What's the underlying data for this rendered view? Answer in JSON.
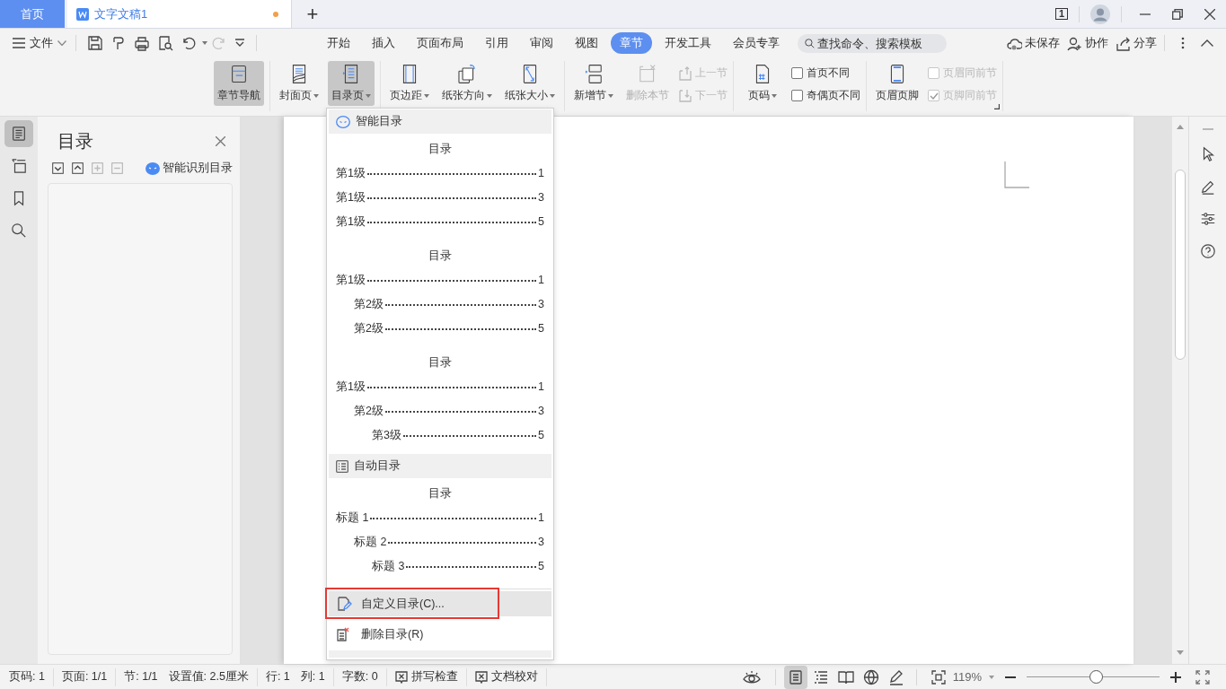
{
  "tabs": [
    {
      "label": "首页",
      "kind": "home",
      "selected": false
    },
    {
      "label": "文字文稿1",
      "kind": "document",
      "selected": true,
      "unsaved": true
    }
  ],
  "new_tab": "+",
  "window_badge": "1",
  "menu_bar": {
    "file": "文件",
    "ribbon_tabs": [
      {
        "label": "开始",
        "selected": false
      },
      {
        "label": "插入",
        "selected": false
      },
      {
        "label": "页面布局",
        "selected": false
      },
      {
        "label": "引用",
        "selected": false
      },
      {
        "label": "审阅",
        "selected": false
      },
      {
        "label": "视图",
        "selected": false
      },
      {
        "label": "章节",
        "selected": true
      },
      {
        "label": "开发工具",
        "selected": false
      },
      {
        "label": "会员专享",
        "selected": false
      }
    ],
    "search": {
      "placeholder": "查找命令、搜索模板"
    },
    "actions": [
      "未保存",
      "协作",
      "分享"
    ]
  },
  "ribbon_groups": [
    [
      {
        "kind": "big",
        "label": "章节导航",
        "dropdown": false,
        "pressed": true,
        "disabled": false
      }
    ],
    [
      {
        "kind": "big",
        "label": "封面页",
        "dropdown": true,
        "pressed": false,
        "disabled": false
      },
      {
        "kind": "big",
        "label": "目录页",
        "dropdown": true,
        "pressed": true,
        "disabled": false
      }
    ],
    [
      {
        "kind": "big",
        "label": "页边距",
        "dropdown": true,
        "pressed": false,
        "disabled": false
      },
      {
        "kind": "big",
        "label": "纸张方向",
        "dropdown": true,
        "pressed": false,
        "disabled": false
      },
      {
        "kind": "big",
        "label": "纸张大小",
        "dropdown": true,
        "pressed": false,
        "disabled": false
      }
    ],
    [
      {
        "kind": "big",
        "label": "新增节",
        "dropdown": true,
        "pressed": false,
        "disabled": false
      },
      {
        "kind": "big",
        "label": "删除本节",
        "dropdown": false,
        "pressed": false,
        "disabled": true
      },
      {
        "kind": "stack",
        "items": [
          {
            "label": "上一节",
            "disabled": true
          },
          {
            "label": "下一节",
            "disabled": true
          }
        ]
      }
    ],
    [
      {
        "kind": "big",
        "label": "页码",
        "dropdown": true,
        "pressed": false,
        "disabled": false
      },
      {
        "kind": "checks",
        "items": [
          {
            "label": "首页不同",
            "checked": false,
            "disabled": false
          },
          {
            "label": "奇偶页不同",
            "checked": false,
            "disabled": false
          }
        ]
      }
    ],
    [
      {
        "kind": "big",
        "label": "页眉页脚",
        "dropdown": false,
        "pressed": false,
        "disabled": false
      },
      {
        "kind": "checks",
        "items": [
          {
            "label": "页眉同前节",
            "checked": false,
            "disabled": true
          },
          {
            "label": "页脚同前节",
            "checked": true,
            "disabled": true
          }
        ]
      }
    ]
  ],
  "side_tools": [
    {
      "selected": true
    },
    {
      "selected": false
    },
    {
      "selected": false
    },
    {
      "selected": false
    }
  ],
  "nav_panel": {
    "title": "目录",
    "smart_button": "智能识别目录"
  },
  "toc_menu": {
    "sections": [
      {
        "heading": "智能目录",
        "kind": "smart",
        "previews": [
          {
            "title": "目录",
            "entries": [
              {
                "label": "第1级",
                "page": "1"
              },
              {
                "label": "第1级",
                "page": "3"
              },
              {
                "label": "第1级",
                "page": "5"
              }
            ]
          },
          {
            "title": "目录",
            "entries": [
              {
                "label": "第1级",
                "page": "1",
                "children": [
                  {
                    "label": "第2级",
                    "page": "3"
                  },
                  {
                    "label": "第2级",
                    "page": "5"
                  }
                ]
              }
            ]
          },
          {
            "title": "目录",
            "entries": [
              {
                "label": "第1级",
                "page": "1",
                "children": [
                  {
                    "label": "第2级",
                    "page": "3",
                    "children": [
                      {
                        "label": "第3级",
                        "page": "5"
                      }
                    ]
                  }
                ]
              }
            ]
          }
        ]
      },
      {
        "heading": "自动目录",
        "kind": "auto",
        "previews": [
          {
            "title": "目录",
            "entries": [
              {
                "label": "标题 1",
                "page": "1",
                "children": [
                  {
                    "label": "标题 2",
                    "page": "3",
                    "children": [
                      {
                        "label": "标题 3",
                        "page": "5"
                      }
                    ]
                  }
                ]
              }
            ]
          }
        ]
      }
    ],
    "actions": [
      {
        "label": "自定义目录(C)...",
        "selected": true,
        "annotated": true
      },
      {
        "label": "删除目录(R)",
        "selected": false,
        "annotated": false
      }
    ]
  },
  "status_bar": {
    "field_groups": [
      [
        "页码: 1"
      ],
      [
        "页面: 1/1"
      ],
      [
        "节: 1/1",
        "设置值: 2.5厘米"
      ],
      [
        "行: 1",
        "列: 1"
      ],
      [
        "字数: 0"
      ]
    ],
    "tools": [
      "拼写检查",
      "文档校对"
    ],
    "views": [
      {
        "selected": true
      },
      {
        "selected": false
      },
      {
        "selected": false
      },
      {
        "selected": false
      },
      {
        "selected": false
      }
    ],
    "zoom": "119%",
    "zoom_slider": {
      "level": 0.52
    }
  }
}
